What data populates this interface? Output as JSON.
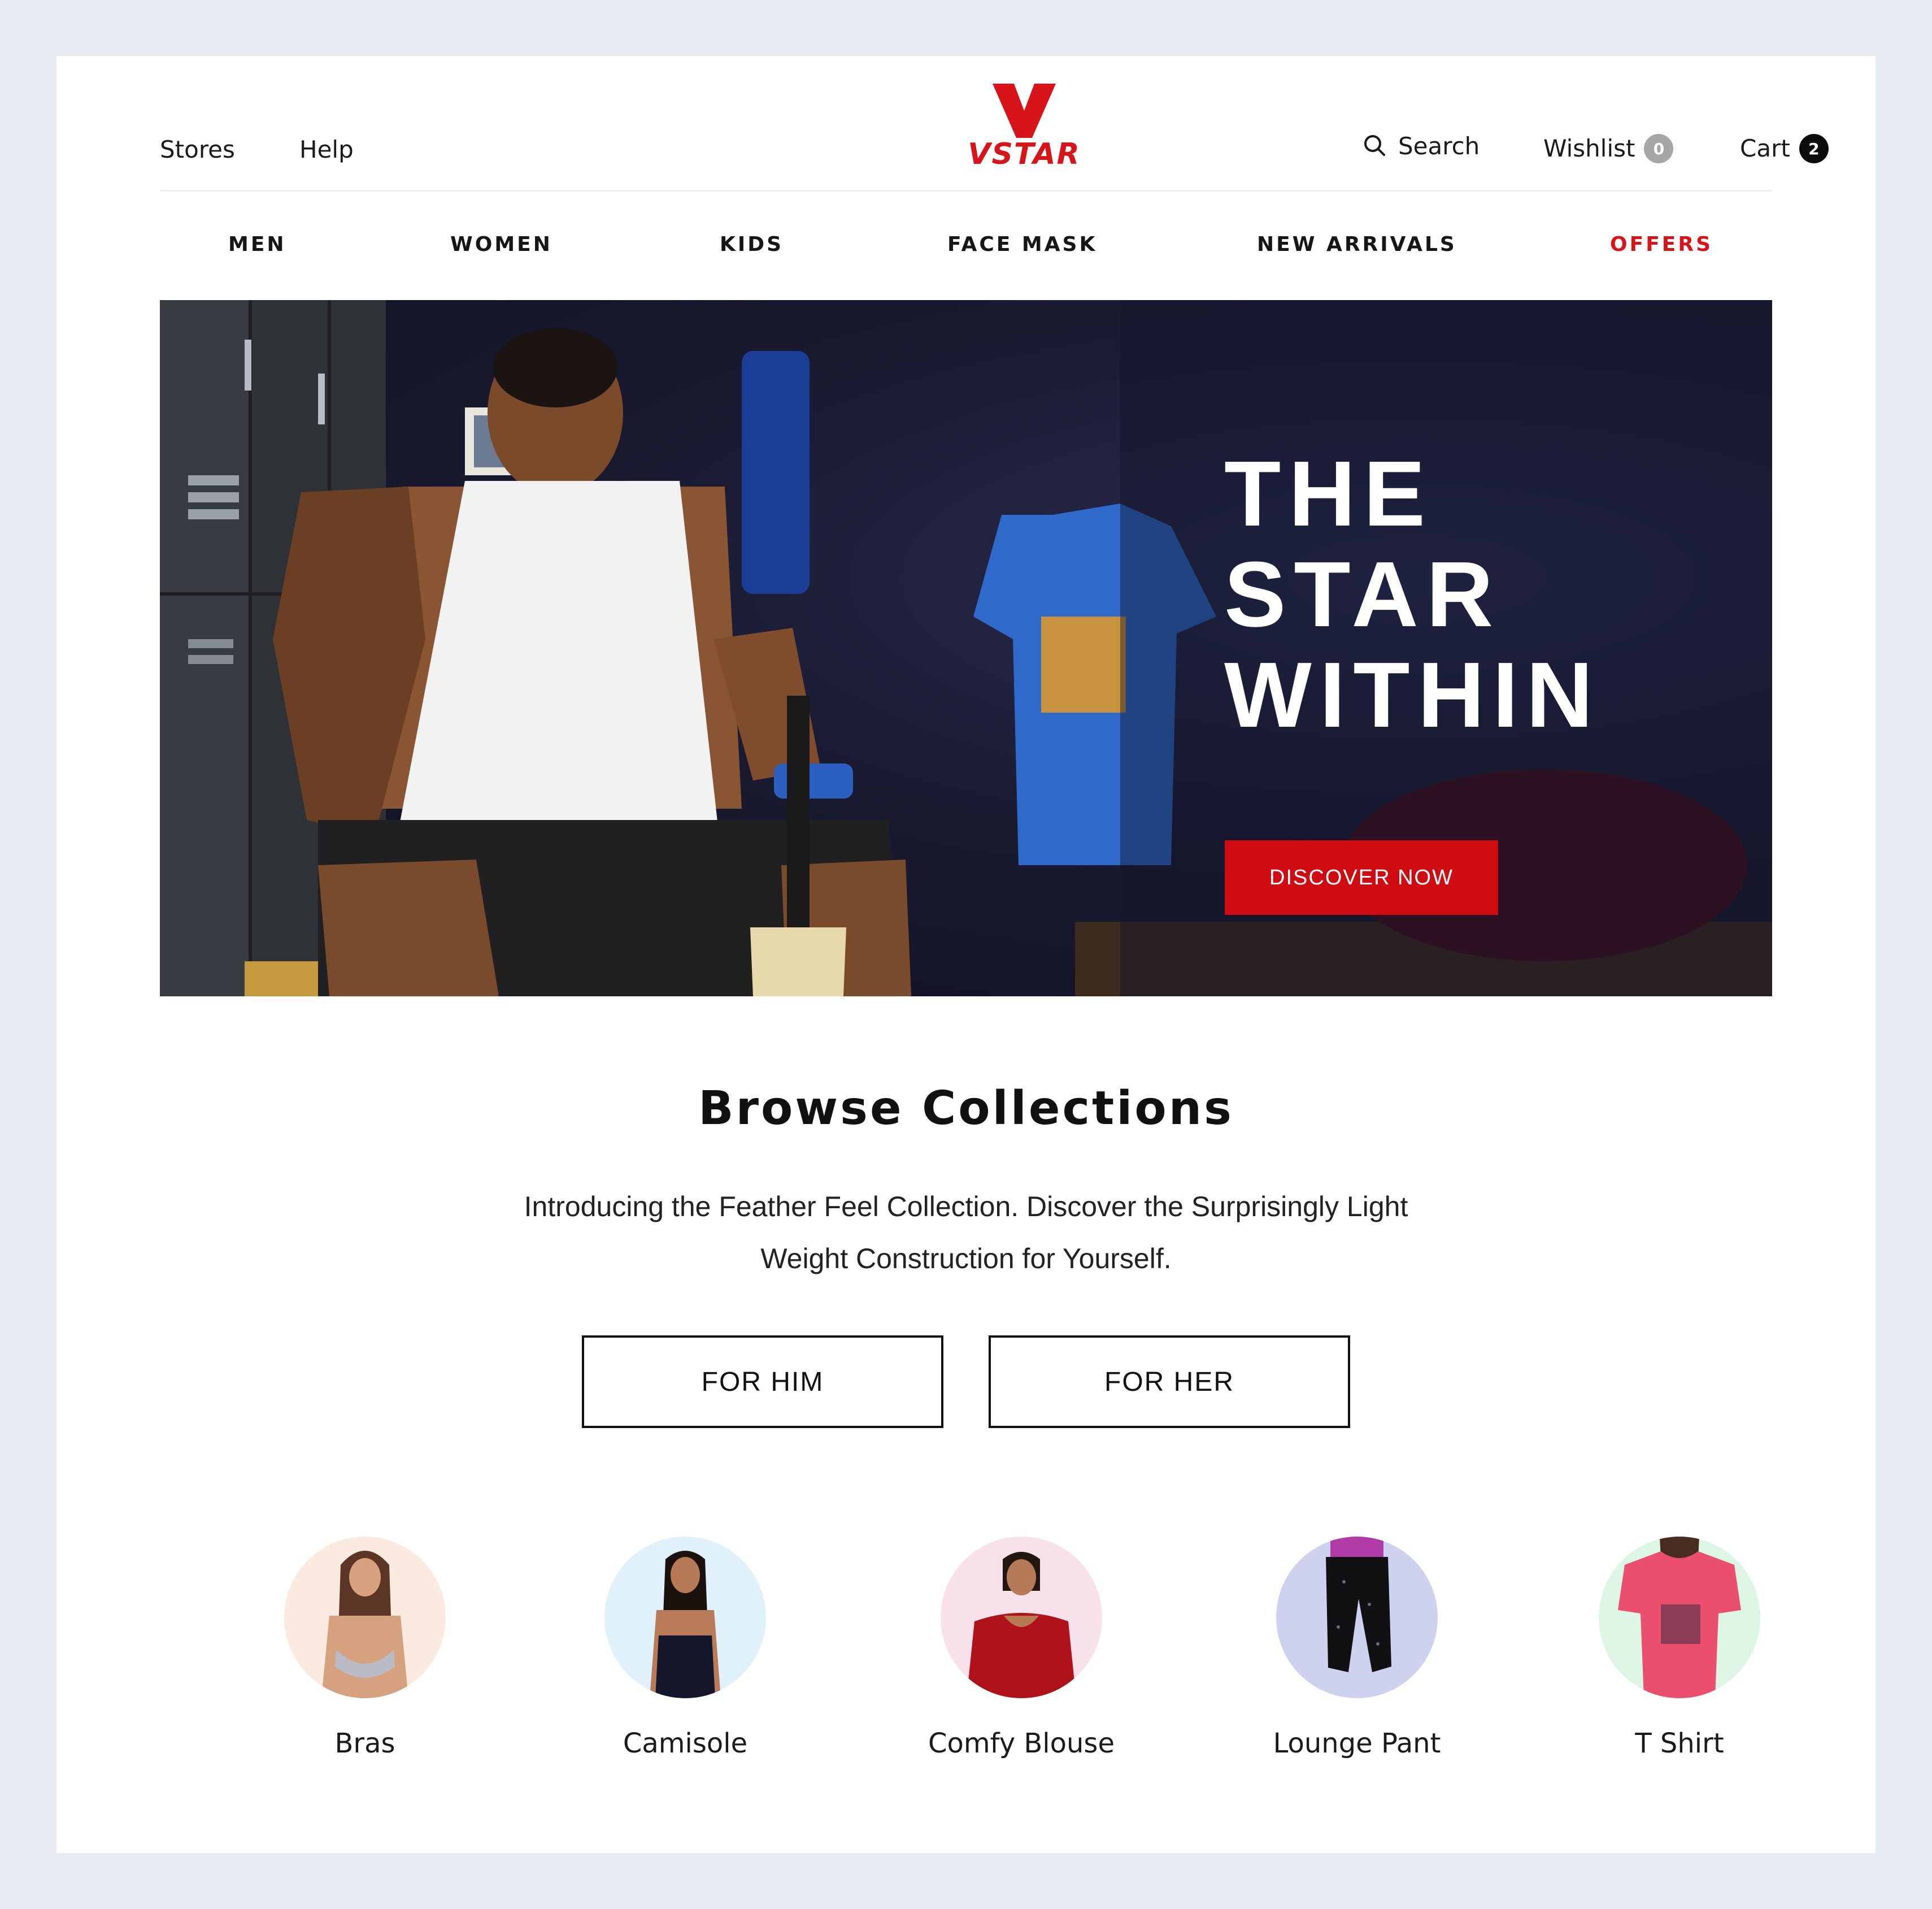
{
  "header": {
    "left_links": [
      "Stores",
      "Help"
    ],
    "logo_text": "VSTAR",
    "search_label": "Search",
    "wishlist_label": "Wishlist",
    "wishlist_count": "0",
    "cart_label": "Cart",
    "cart_count": "2"
  },
  "nav": {
    "items": [
      "MEN",
      "WOMEN",
      "KIDS",
      "FACE MASK",
      "NEW ARRIVALS",
      "OFFERS"
    ]
  },
  "hero": {
    "title_lines": [
      "THE",
      "STAR",
      "WITHIN"
    ],
    "cta_label": "DISCOVER NOW"
  },
  "collections": {
    "title": "Browse Collections",
    "description": "Introducing the Feather Feel Collection. Discover the Surprisingly Light Weight Construction for Yourself.",
    "buttons": [
      "FOR HIM",
      "FOR HER"
    ],
    "categories": [
      "Bras",
      "Camisole",
      "Comfy Blouse",
      "Lounge Pant",
      "T Shirt"
    ]
  },
  "colors": {
    "accent_red": "#cf0a10",
    "offers_red": "#d7141a",
    "page_background": "#e7ebf2"
  }
}
